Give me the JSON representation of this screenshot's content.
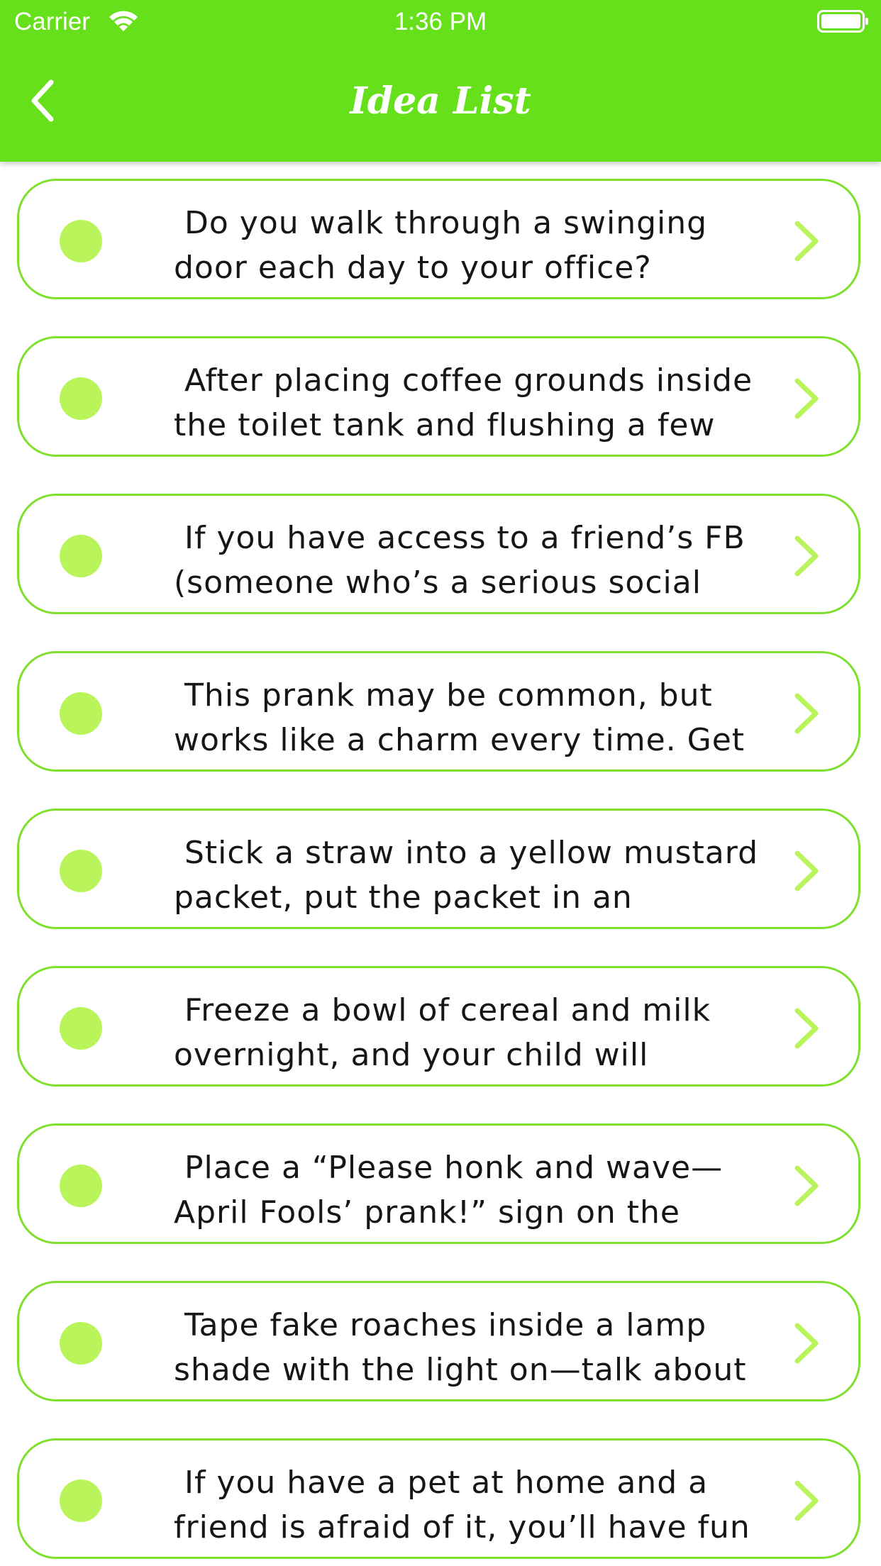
{
  "status_bar": {
    "carrier": "Carrier",
    "time": "1:36 PM",
    "icons": [
      "wifi-icon",
      "battery-icon"
    ]
  },
  "nav": {
    "back_icon": "chevron-left-icon",
    "title": "Idea List"
  },
  "colors": {
    "header": "#66e01a",
    "card_border": "#7ee02c",
    "dot": "#b9f55a",
    "chevron": "#b9f55a"
  },
  "ideas": [
    {
      "text": " Do you walk through a swinging\ndoor each day to your office?"
    },
    {
      "text": " After placing coffee grounds inside\nthe toilet tank and flushing a few"
    },
    {
      "text": " If you have access to a friend’s FB\n(someone who’s a serious social"
    },
    {
      "text": " This prank may be common, but\nworks like a charm every time. Get"
    },
    {
      "text": " Stick a straw into a yellow mustard\npacket, put the packet in an"
    },
    {
      "text": " Freeze a bowl of cereal and milk\novernight, and your child will"
    },
    {
      "text": " Place a “Please honk and wave—\nApril Fools’ prank!” sign on the"
    },
    {
      "text": " Tape fake roaches inside a lamp\nshade with the light on—talk about"
    },
    {
      "text": " If you have a pet at home and a\nfriend is afraid of it, you’ll have fun"
    }
  ]
}
